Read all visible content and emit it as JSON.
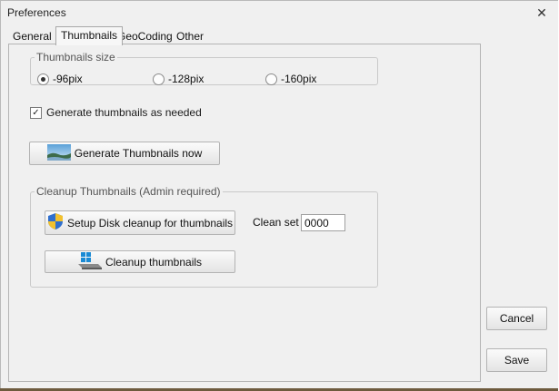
{
  "window": {
    "title": "Preferences",
    "close_glyph": "✕"
  },
  "tabs": [
    {
      "label": "General",
      "active": false
    },
    {
      "label": "Thumbnails",
      "active": true
    },
    {
      "label": "GeoCoding",
      "active": false
    },
    {
      "label": "Other",
      "active": false
    }
  ],
  "thumbnails_size": {
    "legend": "Thumbnails size",
    "options": [
      {
        "label": "-96pix",
        "selected": true
      },
      {
        "label": "-128pix",
        "selected": false
      },
      {
        "label": "-160pix",
        "selected": false
      }
    ]
  },
  "generate_as_needed": {
    "label": "Generate thumbnails as needed",
    "checked": true,
    "check_glyph": "✓"
  },
  "generate_now_button": {
    "label": "Generate Thumbnails now",
    "icon": "landscape-picture-icon"
  },
  "cleanup": {
    "legend": "Cleanup Thumbnails (Admin required)",
    "setup_button_label": "Setup Disk cleanup for thumbnails",
    "setup_button_icon": "uac-shield-icon",
    "clean_set_label": "Clean set",
    "clean_set_value": "0000",
    "cleanup_button_label": "Cleanup thumbnails",
    "cleanup_button_icon": "windows-drive-icon"
  },
  "cancel_button": {
    "label": "Cancel"
  },
  "save_button": {
    "label": "Save"
  }
}
